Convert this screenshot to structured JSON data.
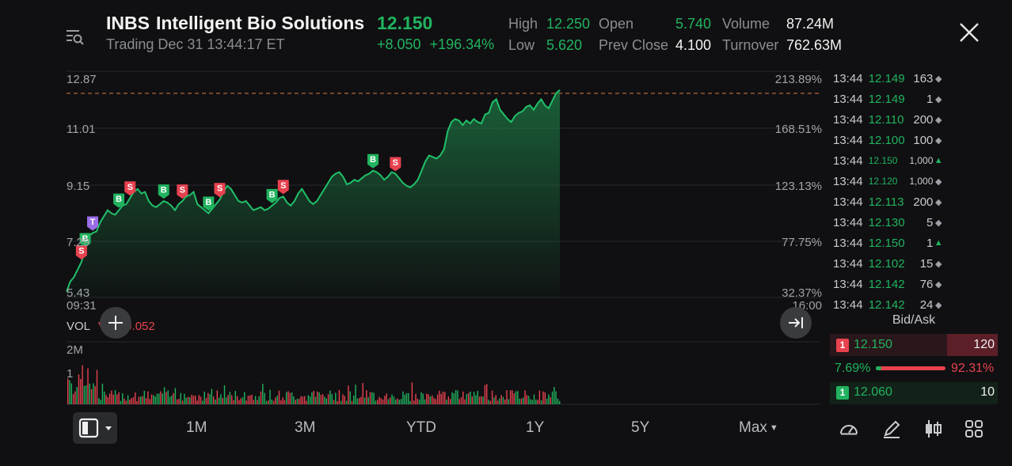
{
  "header": {
    "symbol": "INBS",
    "company": "Intelligent Bio Solutions",
    "last_price": "12.150",
    "trading_status": "Trading Dec 31 13:44:17 ET",
    "change": "+8.050",
    "change_pct": "+196.34%",
    "stats": {
      "high_label": "High",
      "high": "12.250",
      "low_label": "Low",
      "low": "5.620",
      "open_label": "Open",
      "open": "5.740",
      "prev_close_label": "Prev Close",
      "prev_close": "4.100",
      "volume_label": "Volume",
      "volume": "87.24M",
      "turnover_label": "Turnover",
      "turnover": "762.63M"
    }
  },
  "chart": {
    "price_ticks": [
      "12.87",
      "11.01",
      "9.15",
      "7.29",
      "5.43"
    ],
    "pct_ticks": [
      "213.89%",
      "168.51%",
      "123.13%",
      "77.75%",
      "32.37%"
    ],
    "start_time": "09:31",
    "end_time": "16:00",
    "vol_label": "VOL",
    "vol_value": "VOL:0.052",
    "vol_ticks": [
      "2M",
      "1"
    ]
  },
  "chart_data": {
    "type": "line",
    "title": "",
    "xlabel": "",
    "ylabel": "",
    "ylim": [
      5.43,
      12.87
    ],
    "x_range": [
      "09:31",
      "16:00"
    ],
    "series": [
      {
        "values": [
          5.62,
          5.95,
          6.1,
          6.35,
          6.6,
          7.0,
          7.45,
          7.55,
          7.6,
          7.9,
          8.1,
          8.3,
          8.2,
          8.15,
          8.3,
          8.45,
          8.5,
          8.7,
          8.9,
          9.0,
          8.85,
          8.9,
          8.6,
          8.45,
          8.4,
          8.5,
          8.6,
          8.55,
          8.45,
          8.3,
          8.5,
          8.6,
          8.75,
          8.8,
          8.9,
          8.5,
          8.4,
          8.3,
          8.2,
          8.35,
          8.5,
          8.65,
          8.9,
          9.1,
          9.0,
          8.8,
          8.6,
          8.55,
          8.6,
          8.45,
          8.3,
          8.35,
          8.4,
          8.3,
          8.35,
          8.45,
          8.55,
          8.7,
          8.75,
          8.55,
          8.45,
          8.6,
          8.85,
          9.0,
          8.8,
          8.6,
          8.5,
          8.6,
          8.8,
          9.0,
          9.2,
          9.4,
          9.5,
          9.55,
          9.4,
          9.15,
          9.2,
          9.3,
          9.25,
          9.35,
          9.45,
          9.5,
          9.6,
          9.55,
          9.45,
          9.3,
          9.4,
          9.55,
          9.5,
          9.35,
          9.2,
          9.1,
          9.05,
          9.15,
          9.3,
          9.6,
          9.9,
          10.1,
          10.05,
          10.0,
          10.1,
          10.3,
          10.9,
          11.2,
          11.3,
          11.25,
          11.1,
          11.25,
          11.15,
          11.3,
          11.2,
          11.15,
          11.45,
          11.5,
          11.85,
          11.95,
          11.6,
          11.45,
          11.3,
          11.2,
          11.4,
          11.5,
          11.55,
          11.7,
          11.75,
          11.6,
          11.8,
          11.95,
          11.75,
          11.65,
          11.9,
          12.15,
          12.25
        ]
      }
    ],
    "volume": {
      "max_label": "2M"
    }
  },
  "trade_tape": [
    {
      "time": "13:44",
      "price": "12.149",
      "qty": "163",
      "mark": "neutral"
    },
    {
      "time": "13:44",
      "price": "12.149",
      "qty": "1",
      "mark": "neutral"
    },
    {
      "time": "13:44",
      "price": "12.110",
      "qty": "200",
      "mark": "neutral"
    },
    {
      "time": "13:44",
      "price": "12.100",
      "qty": "100",
      "mark": "neutral"
    },
    {
      "time": "13:44",
      "price": "12.150",
      "qty": "1,000",
      "mark": "up"
    },
    {
      "time": "13:44",
      "price": "12.120",
      "qty": "1,000",
      "mark": "neutral"
    },
    {
      "time": "13:44",
      "price": "12.113",
      "qty": "200",
      "mark": "neutral"
    },
    {
      "time": "13:44",
      "price": "12.130",
      "qty": "5",
      "mark": "neutral"
    },
    {
      "time": "13:44",
      "price": "12.150",
      "qty": "1",
      "mark": "up"
    },
    {
      "time": "13:44",
      "price": "12.102",
      "qty": "15",
      "mark": "neutral"
    },
    {
      "time": "13:44",
      "price": "12.142",
      "qty": "76",
      "mark": "neutral"
    },
    {
      "time": "13:44",
      "price": "12.142",
      "qty": "24",
      "mark": "neutral"
    }
  ],
  "bid_ask": {
    "title": "Bid/Ask",
    "ask": {
      "level": "1",
      "price": "12.150",
      "size": "120"
    },
    "bid": {
      "level": "1",
      "price": "12.060",
      "size": "10"
    },
    "bid_pct": "7.69%",
    "ask_pct": "92.31%",
    "bid_fraction": 0.0769
  },
  "timeframes": [
    "1M",
    "3M",
    "YTD",
    "1Y",
    "5Y",
    "Max"
  ],
  "markers": [
    {
      "label": "B",
      "color": "#21b35f"
    },
    {
      "label": "S",
      "color": "#e8424f"
    },
    {
      "label": "T",
      "color": "#9a6ee8"
    }
  ],
  "colors": {
    "up": "#21b35f",
    "down": "#e8424f",
    "background": "#101012"
  }
}
